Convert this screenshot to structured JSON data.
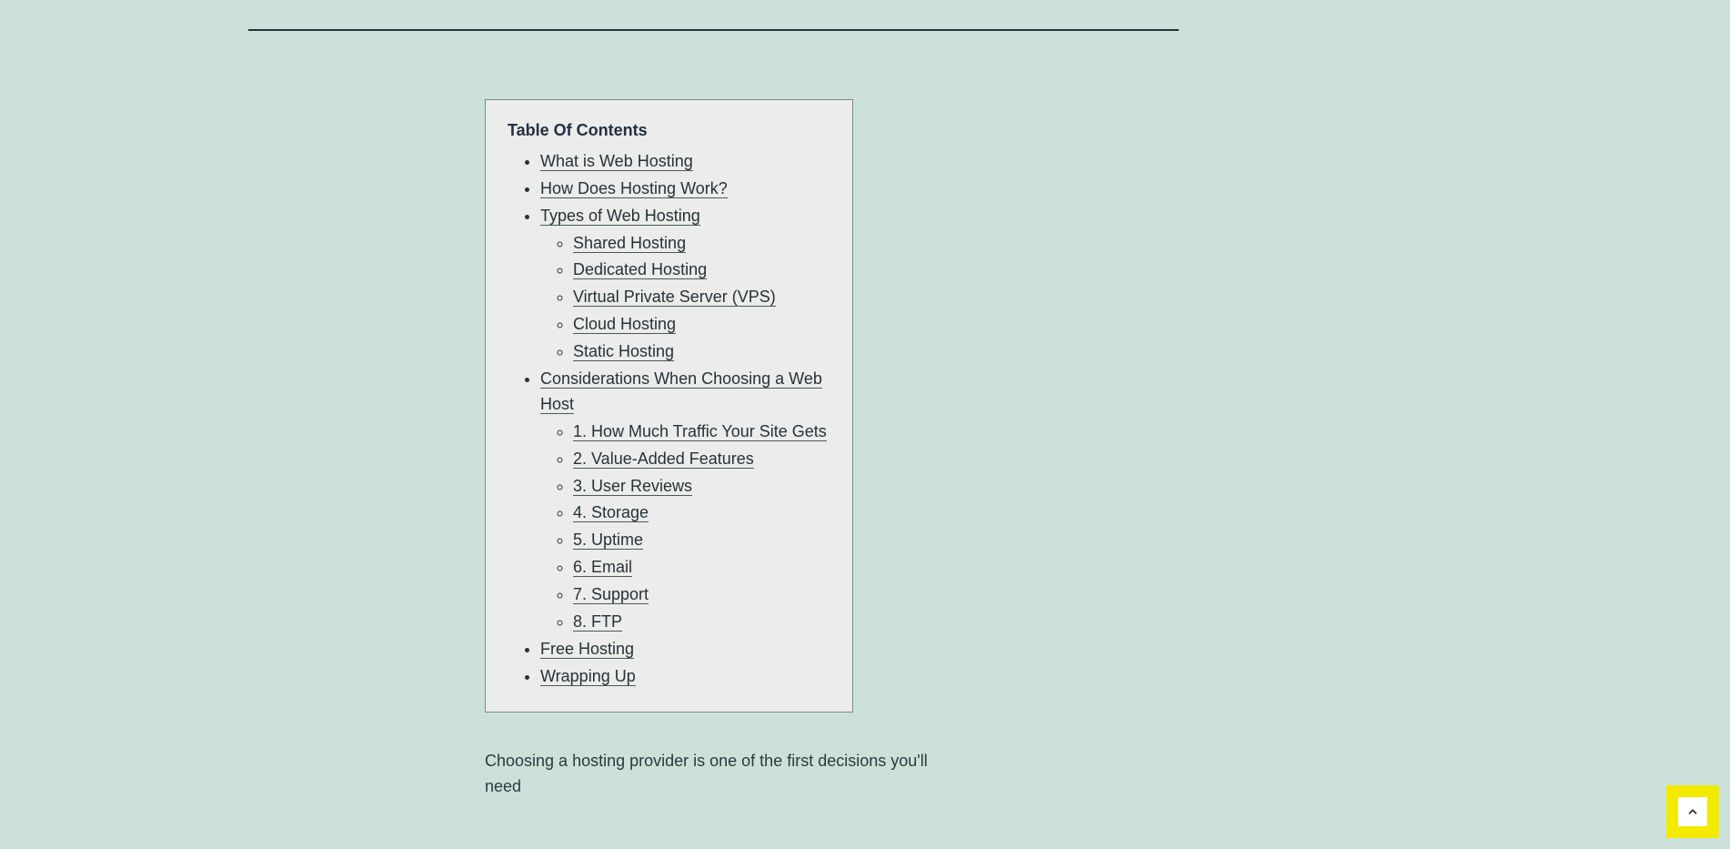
{
  "toc": {
    "title": "Table Of Contents",
    "items": [
      {
        "label": "What is Web Hosting"
      },
      {
        "label": "How Does Hosting Work?"
      },
      {
        "label": "Types of Web Hosting",
        "children": [
          {
            "label": "Shared Hosting"
          },
          {
            "label": "Dedicated Hosting"
          },
          {
            "label": "Virtual Private Server (VPS)"
          },
          {
            "label": "Cloud Hosting"
          },
          {
            "label": "Static Hosting"
          }
        ]
      },
      {
        "label": "Considerations When Choosing a Web Host",
        "children": [
          {
            "label": "1. How Much Traffic Your Site Gets"
          },
          {
            "label": "2. Value-Added Features"
          },
          {
            "label": "3. User Reviews"
          },
          {
            "label": "4. Storage"
          },
          {
            "label": "5. Uptime"
          },
          {
            "label": "6. Email"
          },
          {
            "label": "7. Support"
          },
          {
            "label": "8. FTP"
          }
        ]
      },
      {
        "label": "Free Hosting"
      },
      {
        "label": "Wrapping Up"
      }
    ]
  },
  "body": {
    "p1": "Choosing a hosting provider is one of the first decisions you'll need"
  },
  "scrollTop": {
    "icon": "chevron-up-icon"
  }
}
